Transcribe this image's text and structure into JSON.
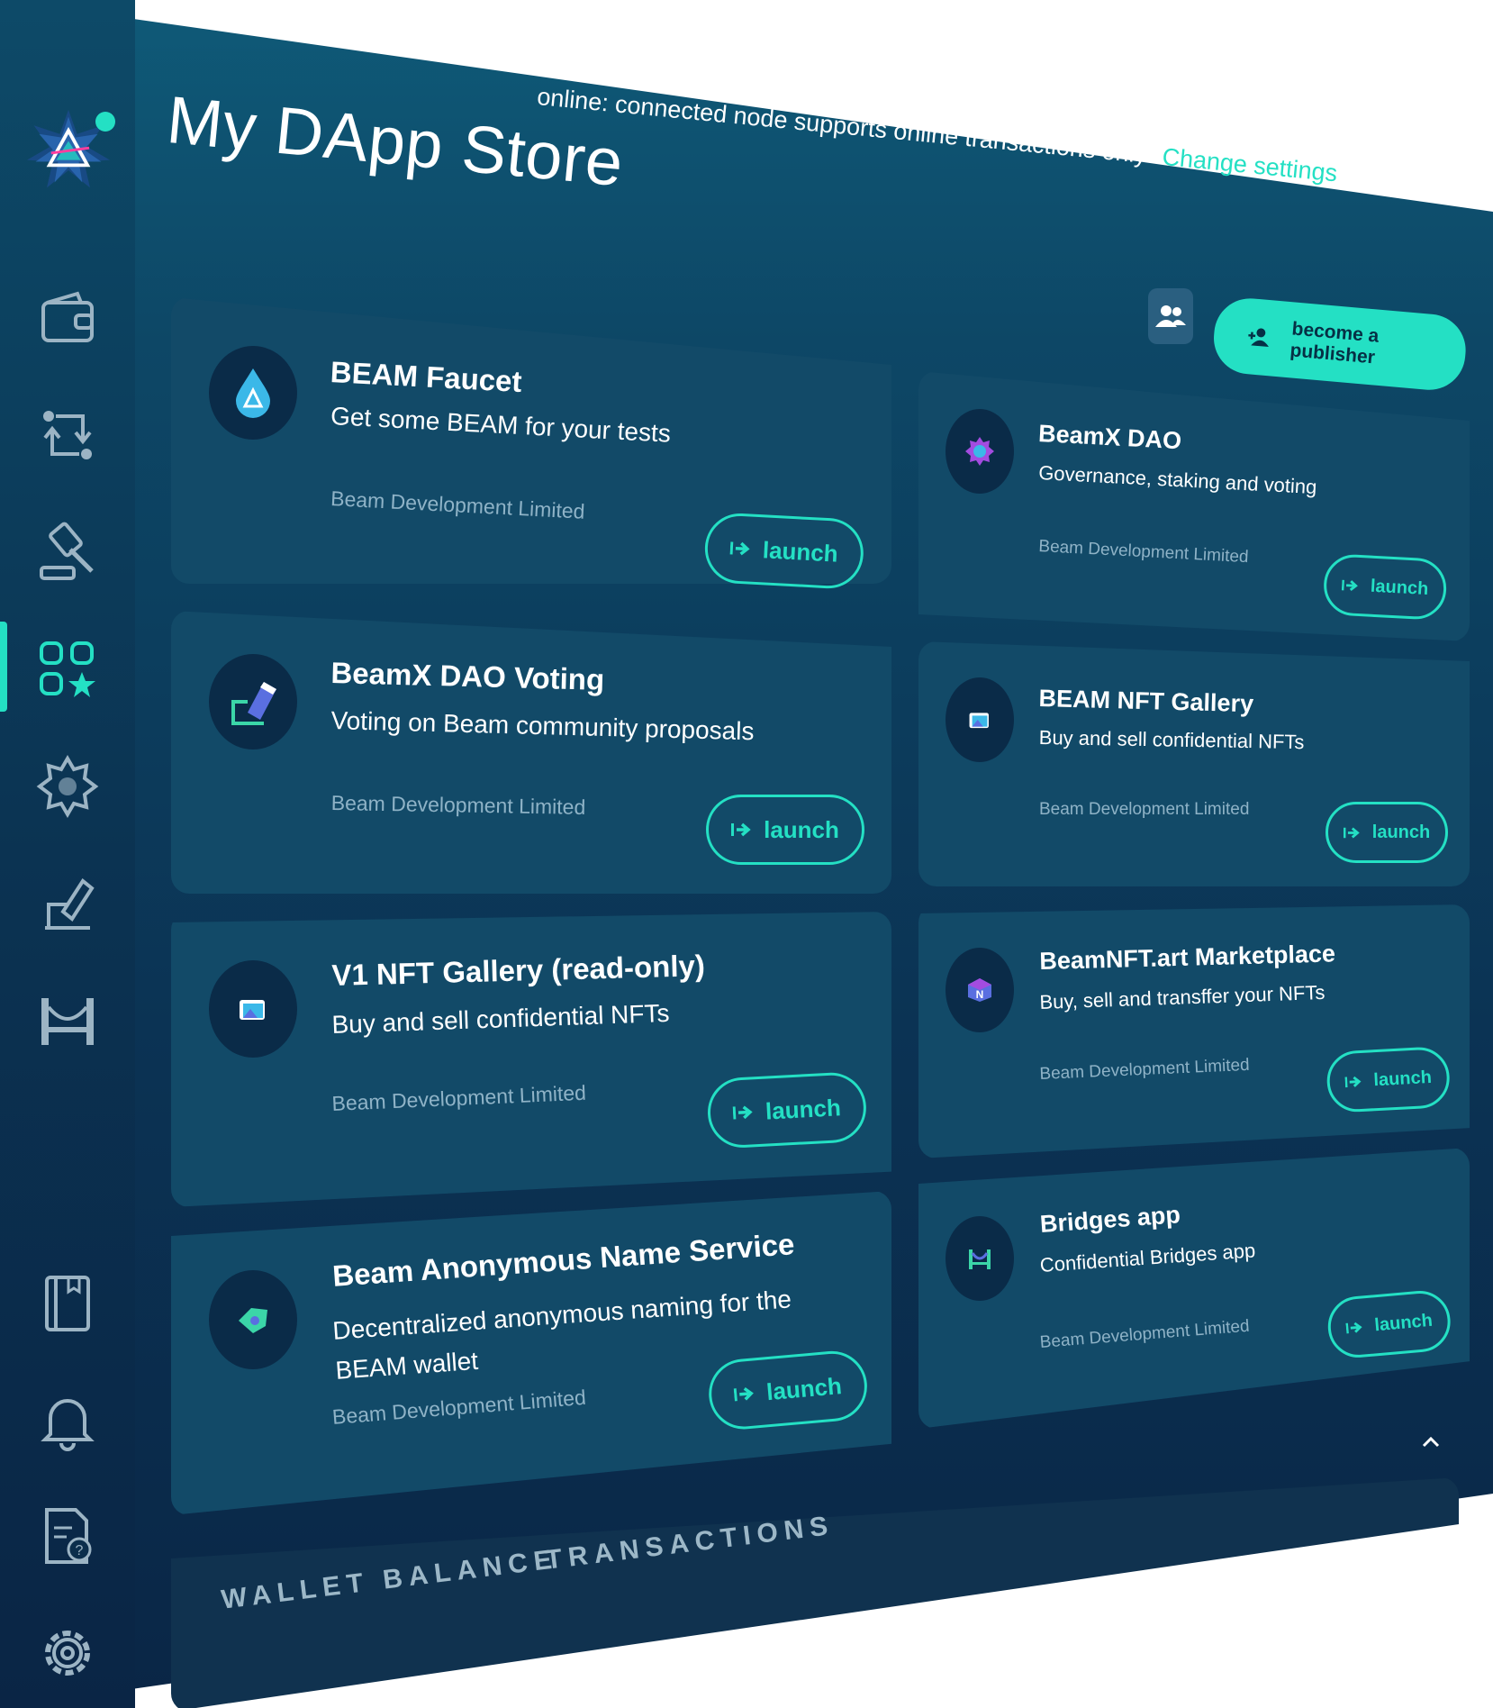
{
  "header": {
    "title": "My DApp Store",
    "status_text": "online: connected node supports online transactions only",
    "status_link": "Change settings",
    "publisher_button": "become a publisher"
  },
  "sidebar": {
    "items": [
      {
        "icon": "wallet-icon"
      },
      {
        "icon": "swap-icon"
      },
      {
        "icon": "auction-icon"
      },
      {
        "icon": "dapp-store-icon",
        "active": true
      },
      {
        "icon": "dao-icon"
      },
      {
        "icon": "voting-icon"
      },
      {
        "icon": "bridge-icon"
      },
      {
        "icon": "notes-icon"
      },
      {
        "icon": "bell-icon"
      },
      {
        "icon": "help-icon"
      },
      {
        "icon": "settings-icon"
      }
    ]
  },
  "apps": [
    {
      "title": "BEAM Faucet",
      "desc": "Get some BEAM for your tests",
      "publisher": "Beam Development Limited",
      "launch": "launch"
    },
    {
      "title": "BeamX DAO",
      "desc": "Governance, staking and voting",
      "publisher": "Beam Development Limited",
      "launch": "launch"
    },
    {
      "title": "BeamX DAO Voting",
      "desc": "Voting on Beam community proposals",
      "publisher": "Beam Development Limited",
      "launch": "launch"
    },
    {
      "title": "BEAM NFT Gallery",
      "desc": "Buy and sell confidential NFTs",
      "publisher": "Beam Development Limited",
      "launch": "launch"
    },
    {
      "title": "V1 NFT Gallery (read-only)",
      "desc": "Buy and sell confidential NFTs",
      "publisher": "Beam Development Limited",
      "launch": "launch"
    },
    {
      "title": "BeamNFT.art Marketplace",
      "desc": "Buy, sell and transffer your NFTs",
      "publisher": "Beam Development Limited",
      "launch": "launch"
    },
    {
      "title": "Beam Anonymous Name Service",
      "desc": "Decentralized anonymous naming for the BEAM wallet",
      "publisher": "Beam Development Limited",
      "launch": "launch"
    },
    {
      "title": "Bridges app",
      "desc": "Confidential Bridges app",
      "publisher": "Beam Development Limited",
      "launch": "launch"
    }
  ],
  "footer": {
    "tab_balance": "WALLET BALANCE",
    "tab_transactions": "TRANSACTIONS"
  },
  "colors": {
    "accent": "#24e0c4",
    "background": "#0b3354",
    "card": "#124a68"
  }
}
